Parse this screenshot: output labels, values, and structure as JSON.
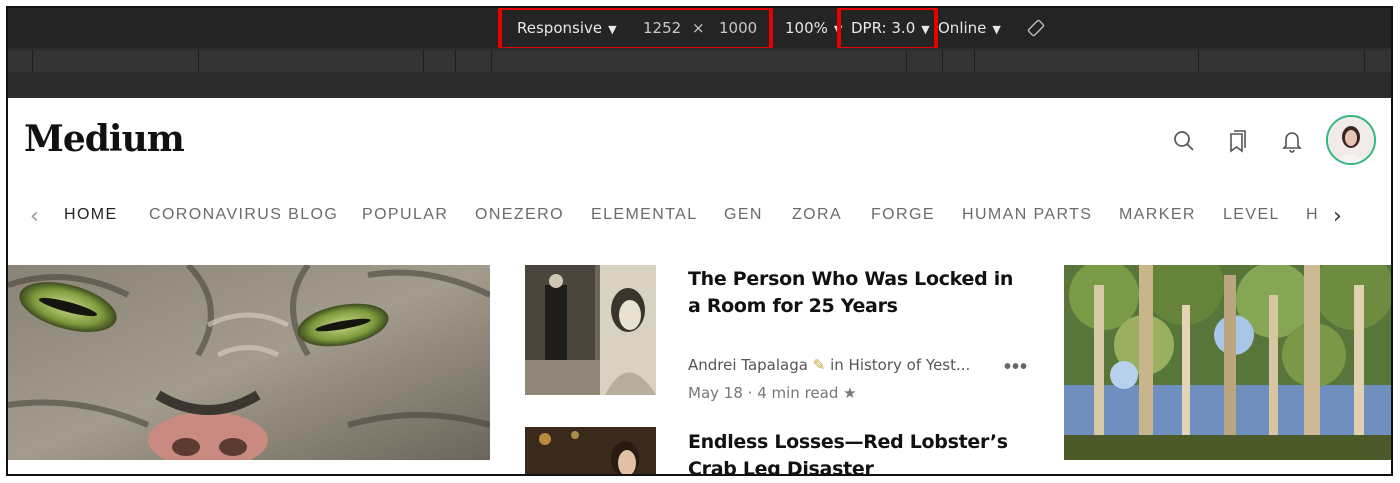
{
  "devtools": {
    "device": "Responsive",
    "width": "1252",
    "times": "×",
    "height": "1000",
    "zoom": "100%",
    "dpr": "DPR: 3.0",
    "network": "Online",
    "caret": "▼"
  },
  "page": {
    "logo": "Medium",
    "nav": {
      "prev": "‹",
      "next": "›",
      "items": [
        "HOME",
        "CORONAVIRUS BLOG",
        "POPULAR",
        "ONEZERO",
        "ELEMENTAL",
        "GEN",
        "ZORA",
        "FORGE",
        "HUMAN PARTS",
        "MARKER",
        "LEVEL",
        "H"
      ]
    },
    "articles": [
      {
        "title": "The Person Who Was Locked in a Room for 25 Years",
        "author": "Andrei Tapalaga",
        "author_badge": "✎",
        "publication": "in History of Yest...",
        "date": "May 18",
        "dot": "·",
        "read_time": "4 min read",
        "star": "★",
        "more": "•••"
      },
      {
        "title": "Endless Losses—Red Lobster’s Crab Leg Disaster"
      }
    ]
  },
  "colors": {
    "devtools_bg": "#242424",
    "highlight": "#e60000",
    "avatar_ring": "#2fb87a"
  }
}
